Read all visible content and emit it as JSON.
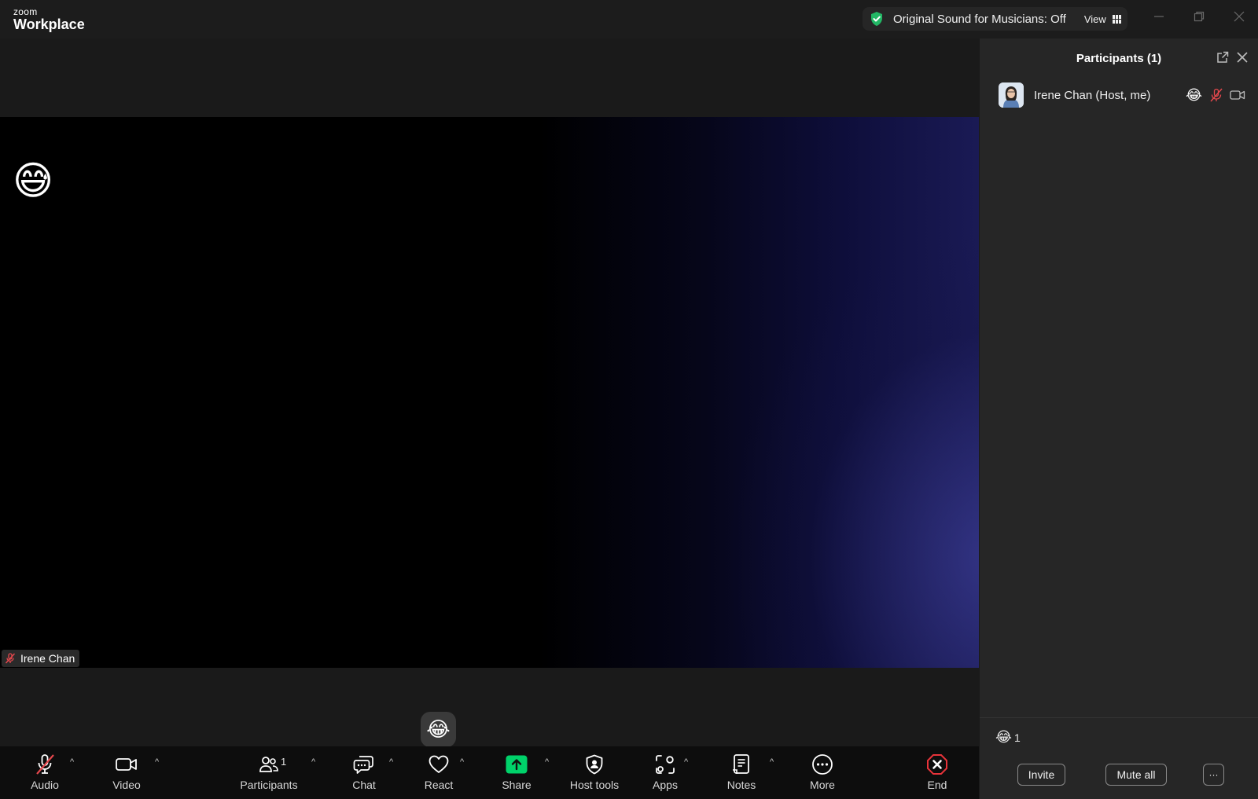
{
  "app": {
    "logo_small": "zoom",
    "logo_big": "Workplace"
  },
  "titlebar": {
    "sound_status": "Original Sound for Musicians: Off",
    "view_label": "View",
    "minimize_icon": "minimize-icon",
    "restore_icon": "restore-icon",
    "close_icon": "close-icon"
  },
  "stage": {
    "reaction_emoji": "😅",
    "name_tag": "Irene Chan"
  },
  "toolbar": {
    "audio": "Audio",
    "video": "Video",
    "participants": "Participants",
    "participants_count": "1",
    "chat": "Chat",
    "react": "React",
    "share": "Share",
    "host_tools": "Host tools",
    "apps": "Apps",
    "notes": "Notes",
    "more": "More",
    "end": "End",
    "react_bubble_emoji": "😂",
    "caret": "^"
  },
  "panel": {
    "title": "Participants (1)",
    "participants": [
      {
        "name": "Irene Chan (Host, me)",
        "reaction": "😂",
        "muted": true,
        "video_off": true
      }
    ],
    "reaction_summary_emoji": "😂",
    "reaction_summary_count": "1",
    "invite": "Invite",
    "mute_all": "Mute all",
    "more": "···"
  },
  "colors": {
    "accent_green": "#0ec46a",
    "share_green": "#00d26a",
    "end_red": "#e8333a",
    "mute_red": "#e5484d",
    "shield_green": "#22b765"
  }
}
